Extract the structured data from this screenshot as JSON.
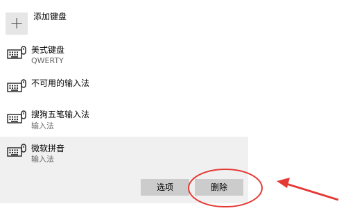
{
  "add_keyboard": {
    "icon": "plus-icon",
    "label": "添加键盘"
  },
  "keyboards": [
    {
      "icon": "keyboard-icon",
      "title": "美式键盘",
      "subtitle": "QWERTY"
    },
    {
      "icon": "keyboard-icon",
      "title": "不可用的输入法",
      "subtitle": ""
    },
    {
      "icon": "keyboard-icon",
      "title": "搜狗五笔输入法",
      "subtitle": "输入法"
    },
    {
      "icon": "keyboard-icon",
      "title": "微软拼音",
      "subtitle": "输入法",
      "selected": true
    }
  ],
  "actions": {
    "options_label": "选项",
    "remove_label": "删除"
  },
  "annotation": {
    "color": "#e53935",
    "shapes": [
      "ellipse",
      "arrow"
    ]
  }
}
